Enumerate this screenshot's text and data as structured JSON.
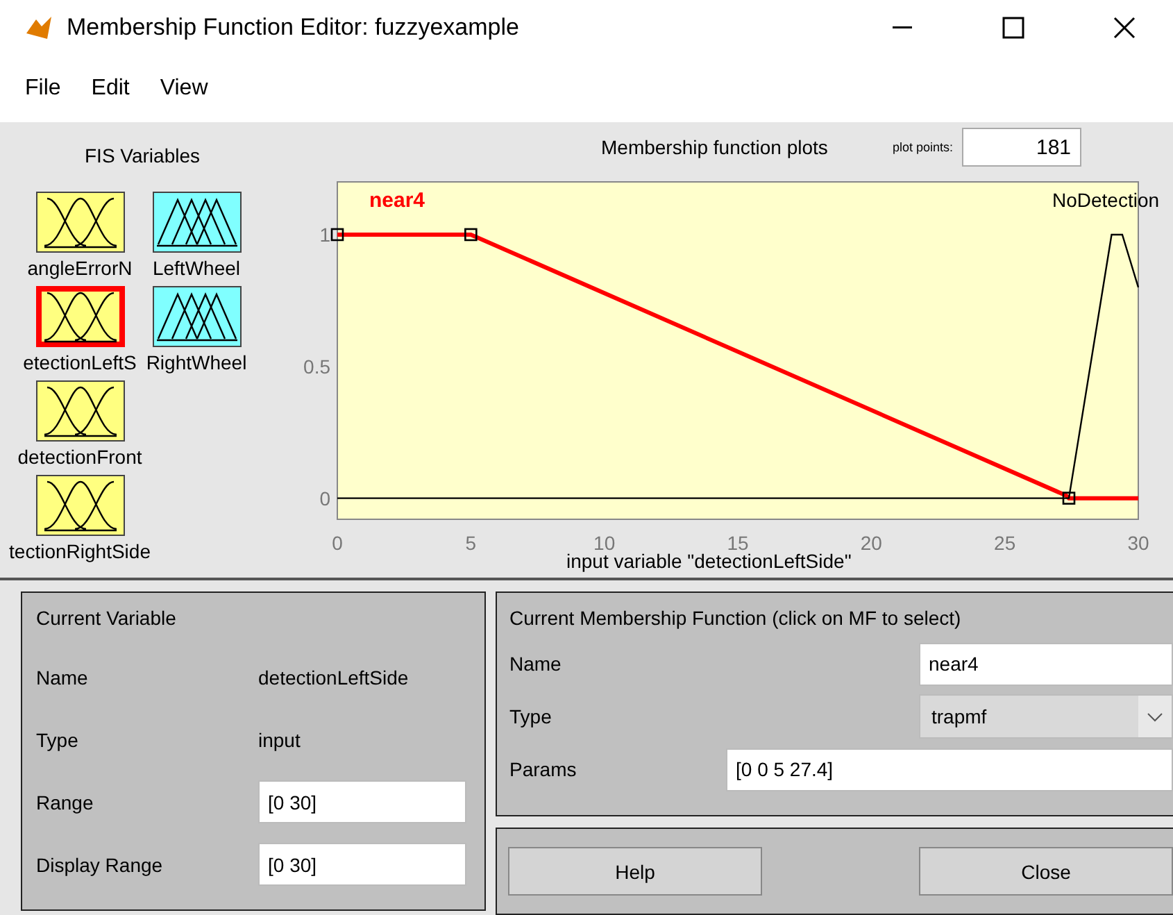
{
  "window": {
    "title": "Membership Function Editor: fuzzyexample"
  },
  "menu": [
    "File",
    "Edit",
    "View"
  ],
  "fis_variables": {
    "title": "FIS Variables",
    "items": [
      {
        "name": "angleErrorN",
        "kind": "input",
        "selected": false
      },
      {
        "name": "LeftWheel",
        "kind": "output",
        "selected": false
      },
      {
        "name": "etectionLeftS",
        "kind": "input",
        "selected": true
      },
      {
        "name": "RightWheel",
        "kind": "output",
        "selected": false
      },
      {
        "name": "detectionFront",
        "kind": "input",
        "selected": false
      },
      {
        "name": "tectionRightSide",
        "kind": "input",
        "selected": false
      }
    ]
  },
  "plot": {
    "title": "Membership function plots",
    "plot_points_label": "plot points:",
    "plot_points": "181",
    "axis_label": "input variable \"detectionLeftSide\"",
    "chart_data": {
      "type": "line",
      "x": [
        0,
        5,
        27.3,
        27.4,
        29,
        29.4,
        30
      ],
      "xlim": [
        0,
        30
      ],
      "ylim": [
        -0.08,
        1.2
      ],
      "xticks": [
        0,
        5,
        10,
        15,
        20,
        25,
        30
      ],
      "yticks": [
        0,
        0.5,
        1
      ],
      "series": [
        {
          "name": "near4",
          "color": "#ff0000",
          "values": [
            1,
            1,
            0.01,
            0,
            0,
            0,
            0
          ]
        },
        {
          "name": "NoDetection",
          "color": "#000000",
          "values": [
            0,
            0,
            0,
            0,
            1,
            1,
            0.8
          ]
        }
      ]
    }
  },
  "current_variable": {
    "title": "Current Variable",
    "rows": [
      {
        "kind": "text",
        "label": "Name",
        "value": "detectionLeftSide"
      },
      {
        "kind": "text",
        "label": "Type",
        "value": "input"
      },
      {
        "kind": "field",
        "label": "Range",
        "value": "[0 30]"
      },
      {
        "kind": "field",
        "label": "Display Range",
        "value": "[0 30]"
      }
    ]
  },
  "current_mf": {
    "title": "Current Membership Function (click on MF to select)",
    "name_label": "Name",
    "name": "near4",
    "type_label": "Type",
    "type": "trapmf",
    "params_label": "Params",
    "params": "[0 0 5 27.4]"
  },
  "buttons": [
    "Help",
    "Close"
  ]
}
